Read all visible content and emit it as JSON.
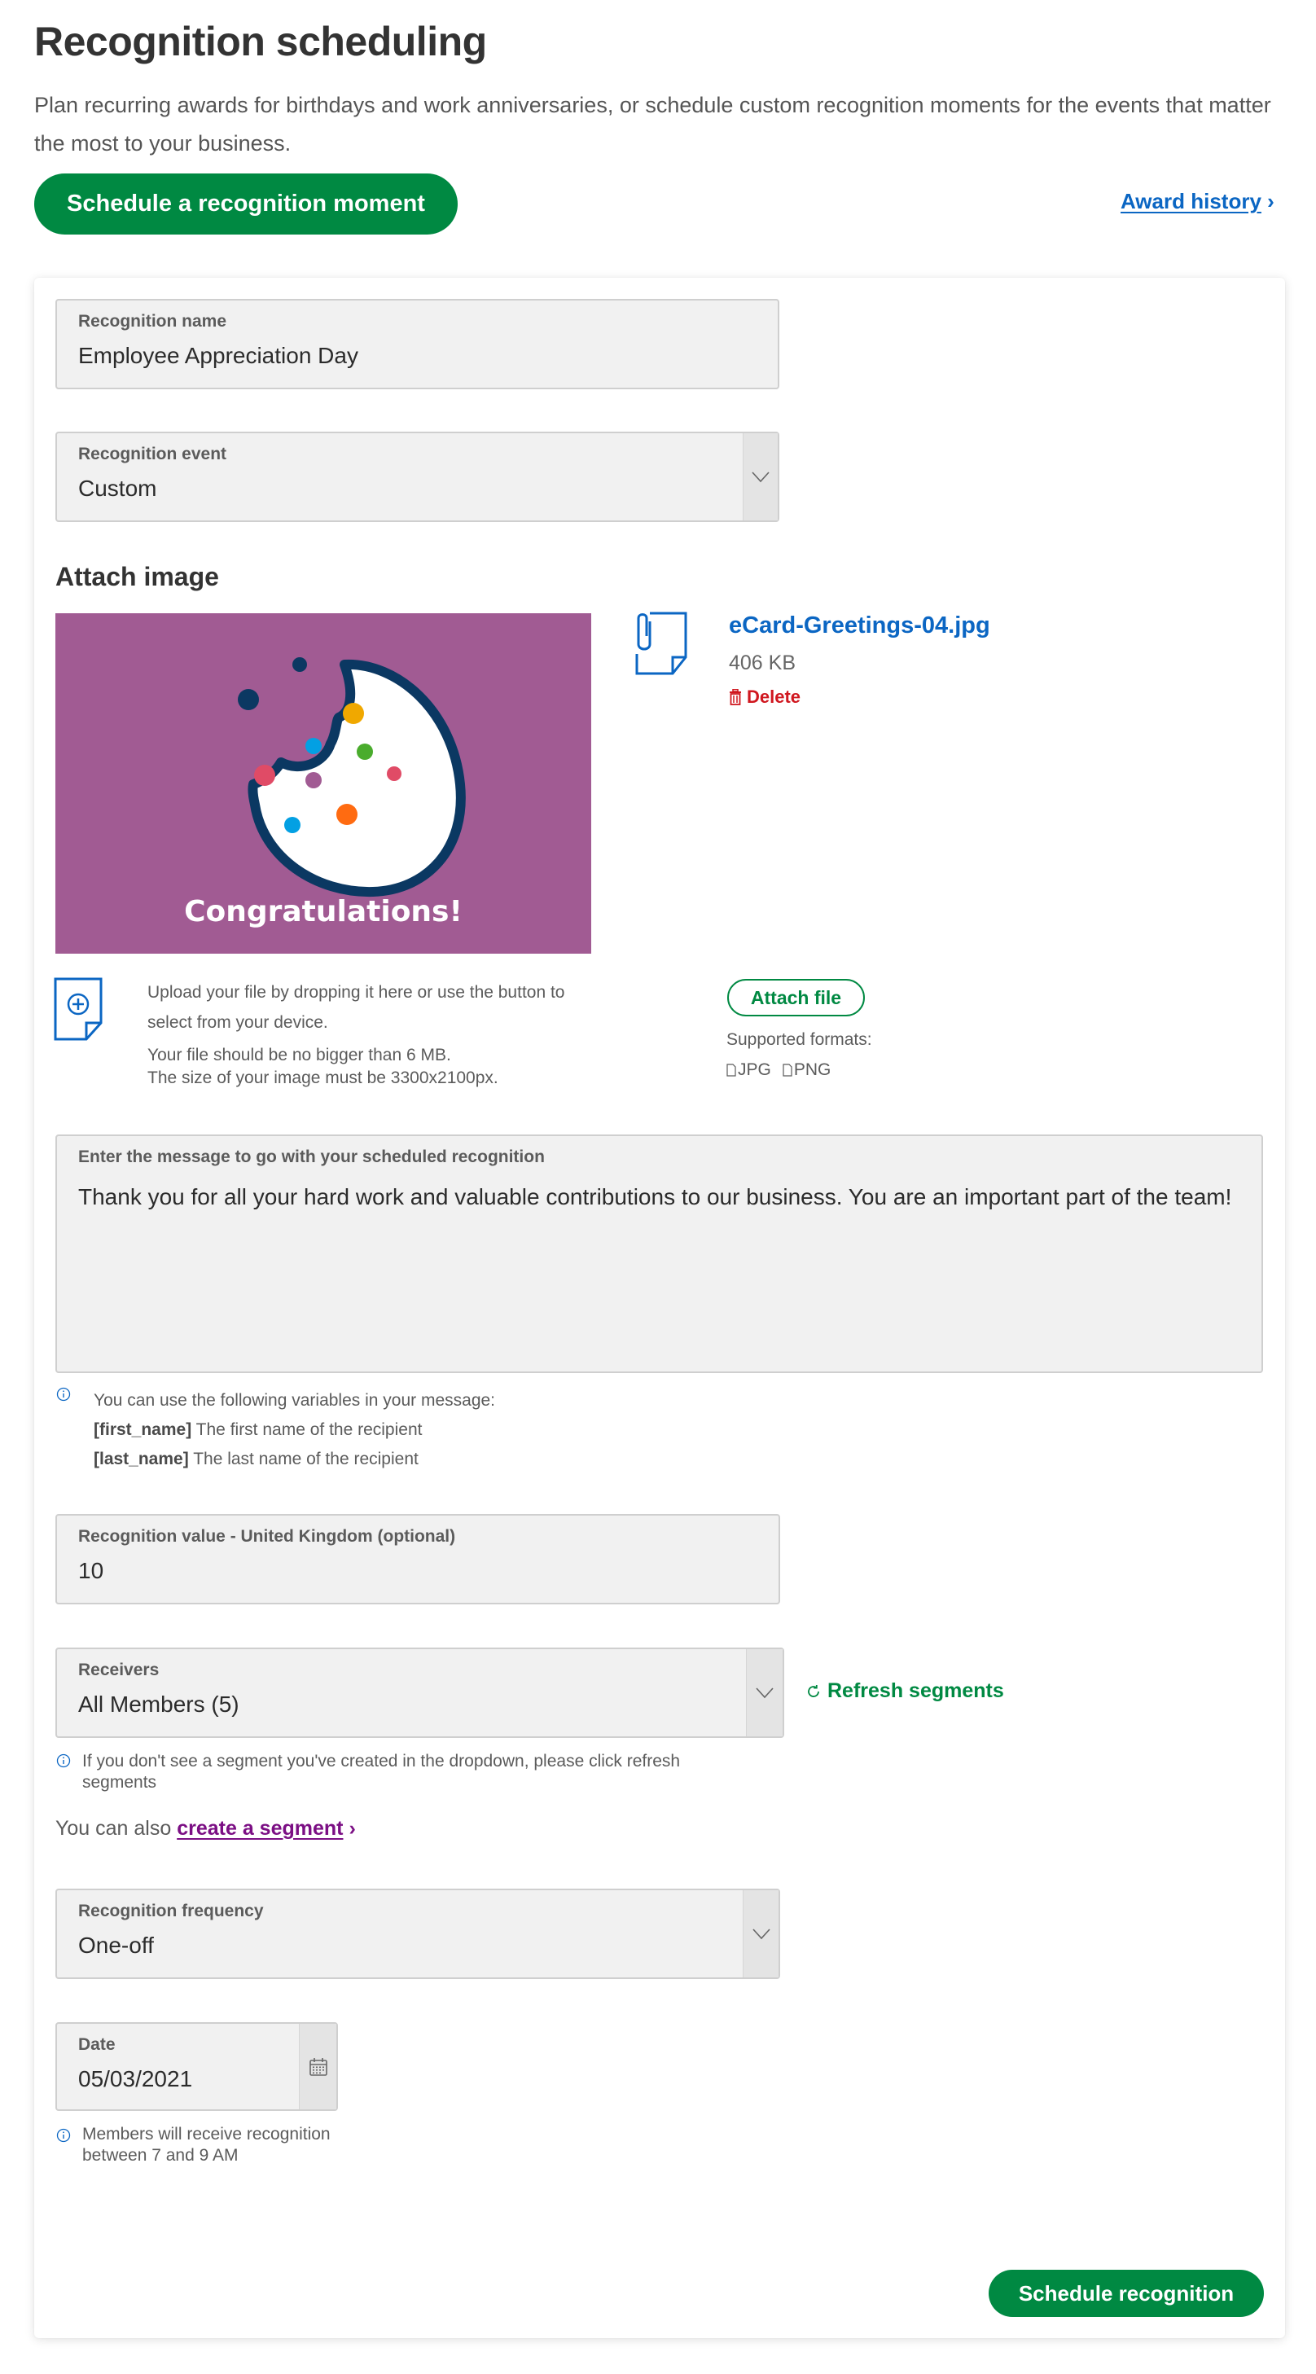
{
  "header": {
    "title": "Recognition scheduling",
    "description": "Plan recurring awards for birthdays and work anniversaries, or schedule custom recognition moments for the events that matter the most to your business.",
    "primary_button": "Schedule a recognition moment",
    "award_history_link": "Award history",
    "award_history_arrow": "›"
  },
  "form": {
    "recognition_name": {
      "label": "Recognition name",
      "value": "Employee Appreciation Day"
    },
    "recognition_event": {
      "label": "Recognition event",
      "value": "Custom"
    },
    "attach_image": {
      "heading": "Attach image",
      "preview_caption": "Congratulations!",
      "file_name": "eCard-Greetings-04.jpg",
      "file_size": "406 KB",
      "delete_label": "Delete",
      "upload_instructions_1": "Upload your file by dropping it here or use the button to",
      "upload_instructions_2": "select from your device.",
      "size_limit": "Your file should be no bigger than 6 MB.",
      "dimension_requirement": "The size of your image must be 3300x2100px.",
      "attach_button": "Attach file",
      "supported_formats_label": "Supported formats:",
      "formats": [
        "JPG",
        "PNG"
      ]
    },
    "message": {
      "label": "Enter the message to go with your scheduled recognition",
      "value": "Thank you for all your hard work and valuable contributions to our business. You are an important part of the team!",
      "variables_intro": "You can use the following variables in your message:",
      "variables": [
        {
          "token": "[first_name]",
          "description": "The first name of the recipient"
        },
        {
          "token": "[last_name]",
          "description": "The last name of the recipient"
        }
      ]
    },
    "recognition_value": {
      "label": "Recognition value - United Kingdom (optional)",
      "value": "10"
    },
    "receivers": {
      "label": "Receivers",
      "value": "All Members (5)",
      "refresh_label": "Refresh segments",
      "hint_line_1": "If you don't see a segment you've created in the dropdown, please click refresh",
      "hint_line_2": "segments",
      "also_prefix": "You can also",
      "create_segment_link": "create a segment",
      "create_segment_arrow": "›"
    },
    "frequency": {
      "label": "Recognition frequency",
      "value": "One-off"
    },
    "date": {
      "label": "Date",
      "value": "05/03/2021",
      "hint": "Members will receive recognition between 7 and 9 AM"
    },
    "submit_button": "Schedule recognition"
  },
  "colors": {
    "primary_green": "#008942",
    "link_blue": "#0b66c3",
    "delete_red": "#d0171f",
    "visited_purple": "#7b0f84",
    "preview_background": "#a15b93",
    "cookie_outline": "#0b3862"
  },
  "icons": {
    "file_attachment": "paperclip-document-icon",
    "delete": "trash-icon",
    "upload": "document-plus-icon",
    "format": "document-icon",
    "info": "info-circle-icon",
    "refresh": "refresh-icon",
    "chevron": "chevron-down-icon",
    "calendar": "calendar-icon"
  }
}
